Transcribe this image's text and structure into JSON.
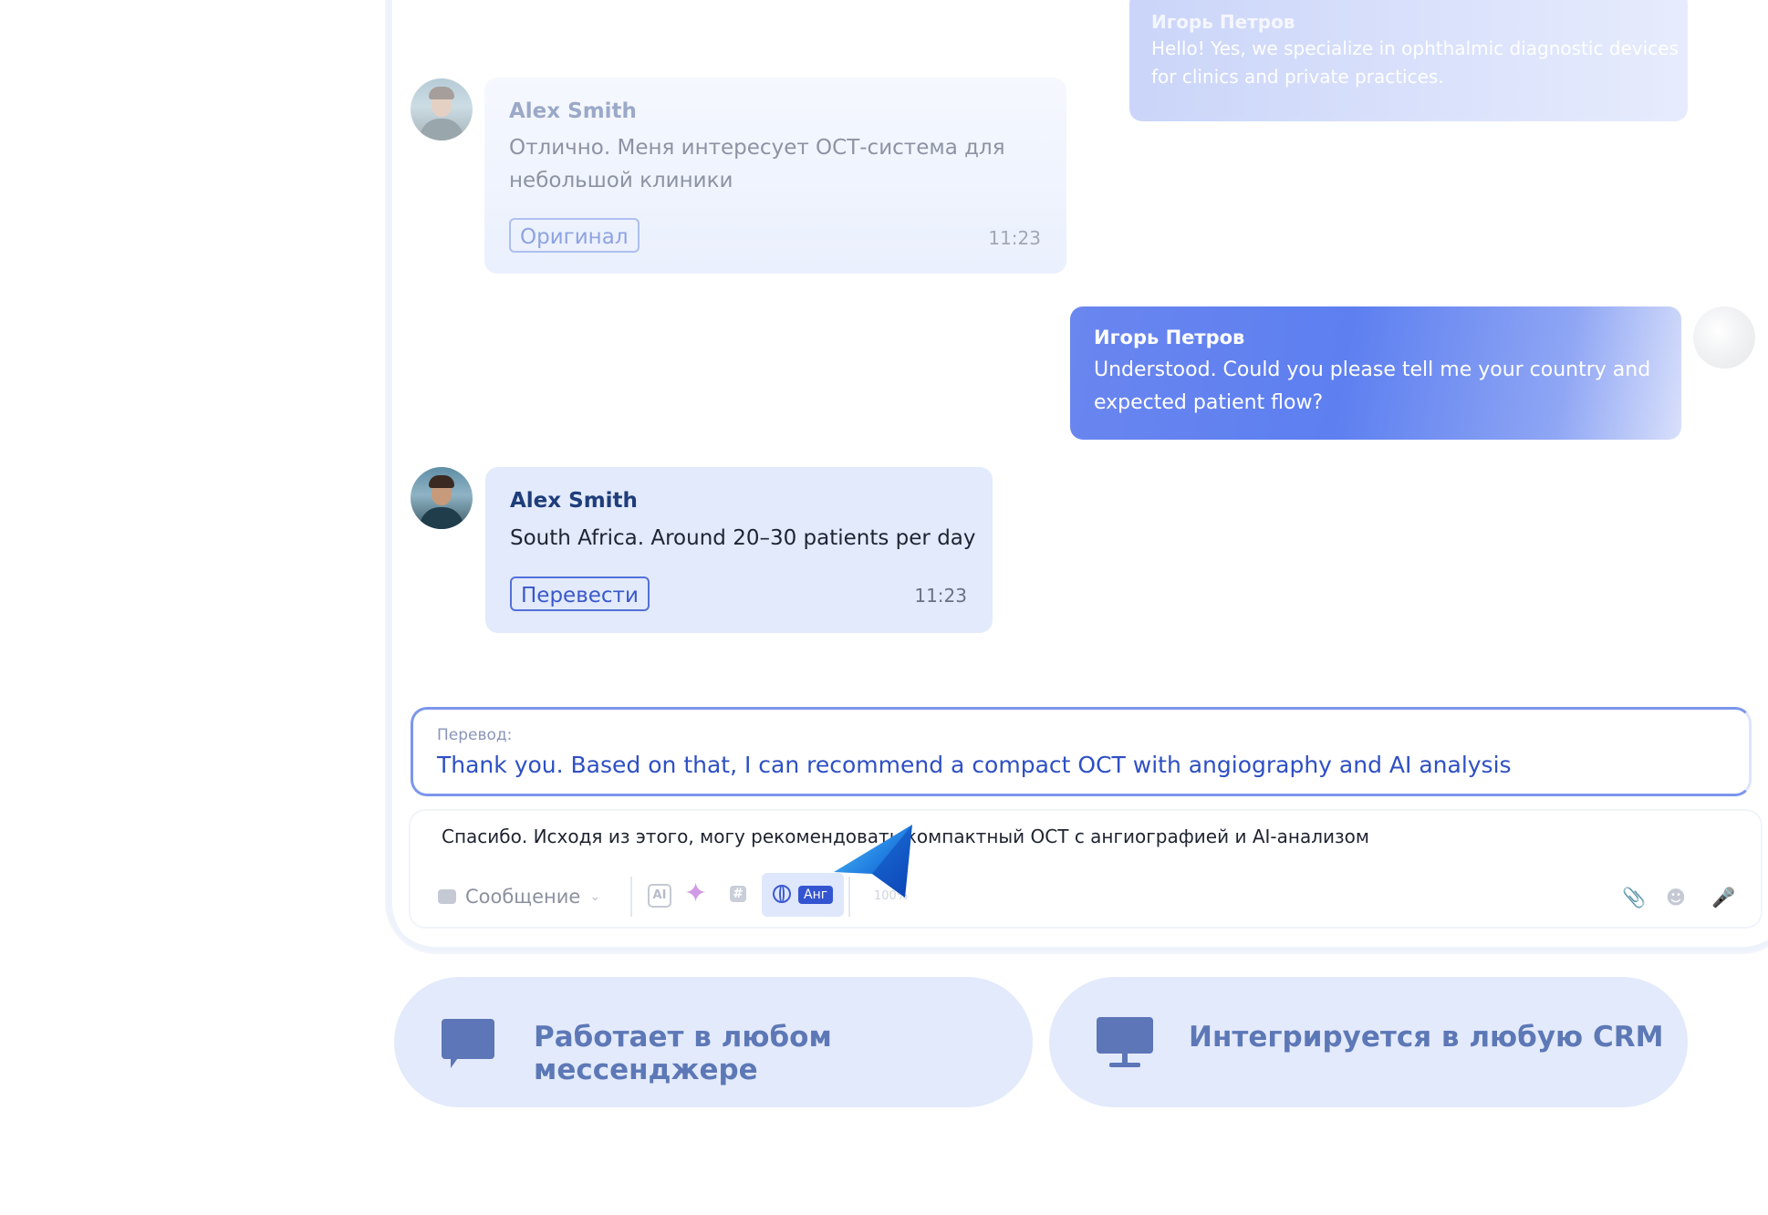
{
  "messages": {
    "top_faded": {
      "name": "Игорь Петров",
      "text": "Hello! Yes, we specialize in ophthalmic diagnostic devices for clinics and private practices."
    },
    "alex_1": {
      "name": "Alex Smith",
      "text": "Отлично. Меня интересует ОСТ-система для небольшой клиники",
      "button": "Оригинал",
      "time": "11:23"
    },
    "igor_1": {
      "name": "Игорь Петров",
      "text": "Understood. Could you please tell me your country and expected patient flow?"
    },
    "alex_2": {
      "name": "Alex Smith",
      "text": "South Africa. Around 20–30 patients per day",
      "button": "Перевести",
      "time": "11:23"
    }
  },
  "translation": {
    "label": "Перевод:",
    "text": "Thank you. Based on that, I can recommend a compact OCT with angiography and AI analysis"
  },
  "composer": {
    "draft": "Спасибо. Исходя из этого, могу рекомендовать компактный ОСТ с ангиографией и AI-анализом",
    "message_type": "Сообщение",
    "ai_icon_text": "AI",
    "lang_tag": "Анг",
    "percent": "100%"
  },
  "features": {
    "messenger": "Работает в любом мессенджере",
    "crm": "Интегрируется в любую CRM"
  },
  "colors": {
    "accent": "#3455d1",
    "bubble_incoming": "#e2eafc",
    "bubble_outgoing": "#5d7ff0",
    "pill_bg": "#e3eafb",
    "pill_text": "#5d78b6"
  },
  "icons": [
    "chat-icon",
    "monitor-icon",
    "globe-icon",
    "sparkle-icon",
    "hash-icon",
    "attach-icon",
    "emoji-icon",
    "mic-icon",
    "cursor-icon"
  ]
}
